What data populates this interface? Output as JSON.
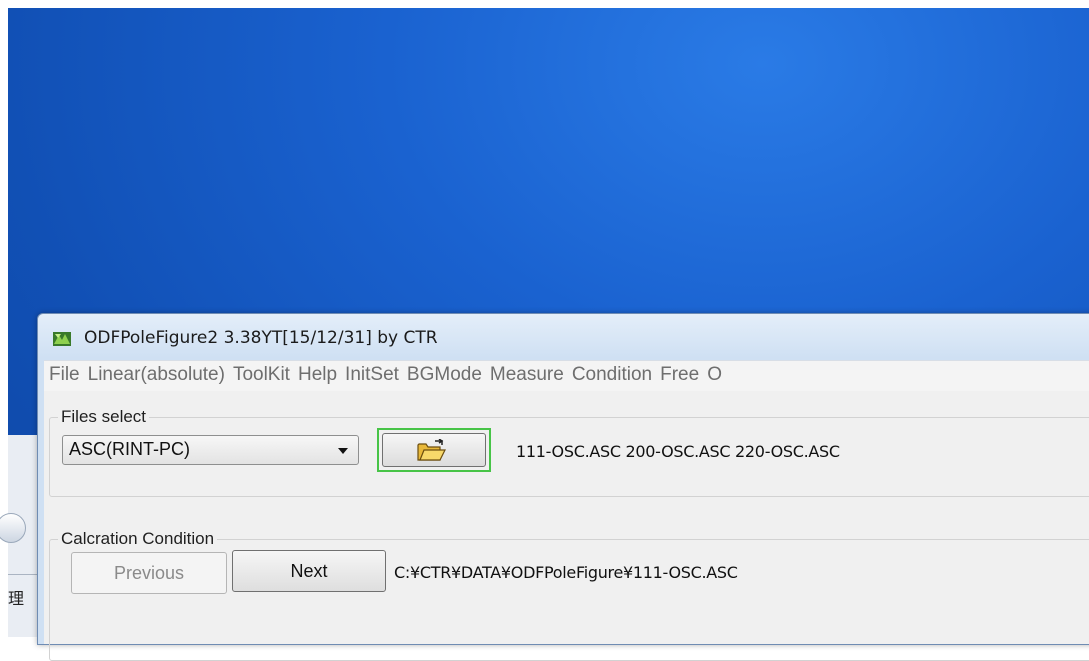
{
  "window": {
    "title": "ODFPoleFigure2 3.38YT[15/12/31] by CTR"
  },
  "menu": {
    "items": [
      "File",
      "Linear(absolute)",
      "ToolKit",
      "Help",
      "InitSet",
      "BGMode",
      "Measure",
      "Condition",
      "Free",
      "O"
    ]
  },
  "files_select": {
    "label": "Files select",
    "format": "ASC(RINT-PC)",
    "files": "111-OSC.ASC 200-OSC.ASC 220-OSC.ASC"
  },
  "calc_condition": {
    "label": "Calcration Condition",
    "previous_label": "Previous",
    "next_label": "Next",
    "path": "C:¥CTR¥DATA¥ODFPoleFigure¥111-OSC.ASC"
  },
  "background_window": {
    "text": "理"
  },
  "colors": {
    "desktop": "#1a62d0",
    "focus_border": "#47c447"
  }
}
